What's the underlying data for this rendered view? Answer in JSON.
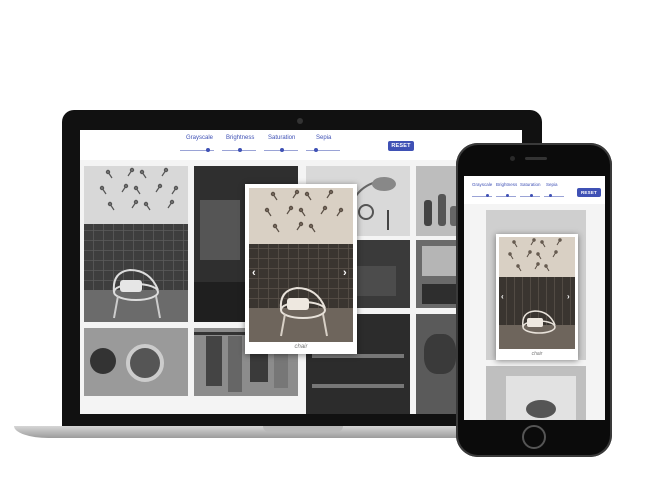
{
  "controls": {
    "grayscale": "Grayscale",
    "brightness": "Brightness",
    "saturation": "Saturation",
    "sepia": "Sepia",
    "grayscale_level": 0.78,
    "brightness_level": 0.5,
    "saturation_level": 0.5,
    "sepia_level": 0.25,
    "reset": "RESET"
  },
  "popup": {
    "caption": "chair",
    "prev_icon": "chevron-left-icon",
    "next_icon": "chevron-right-icon"
  },
  "colors": {
    "accent": "#3f51b5",
    "device": "#111111"
  }
}
